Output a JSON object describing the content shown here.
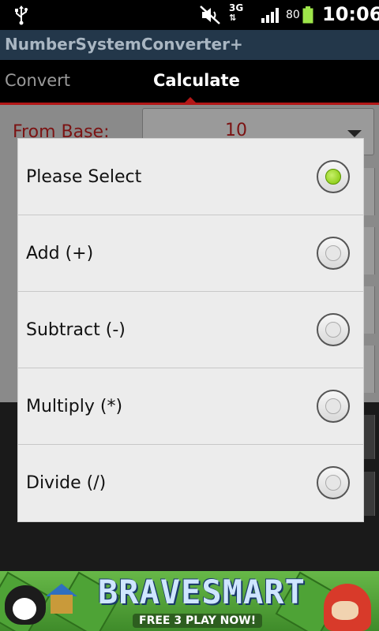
{
  "status_bar": {
    "network": "3G",
    "battery_percent": "80",
    "time": "10:06",
    "icons": [
      "usb-icon",
      "mute-icon",
      "network-3g-icon",
      "signal-icon",
      "battery-icon"
    ]
  },
  "app": {
    "title": "NumberSystemConverter+"
  },
  "tabs": [
    {
      "label": "Convert",
      "active": false
    },
    {
      "label": "Calculate",
      "active": true
    }
  ],
  "form": {
    "from_base_label": "From Base:",
    "from_base_value": "10"
  },
  "dialog": {
    "options": [
      {
        "label": "Please Select",
        "checked": true
      },
      {
        "label": "Add (+)",
        "checked": false
      },
      {
        "label": "Subtract (-)",
        "checked": false
      },
      {
        "label": "Multiply (*)",
        "checked": false
      },
      {
        "label": "Divide (/)",
        "checked": false
      }
    ]
  },
  "ad": {
    "title": "BRAVESMART",
    "subtitle": "FREE 3 PLAY NOW!"
  },
  "colors": {
    "title_bar": "#23374a",
    "tab_accent": "#b31717",
    "dialog_bg": "#ececec",
    "radio_checked": "#7cc300"
  }
}
